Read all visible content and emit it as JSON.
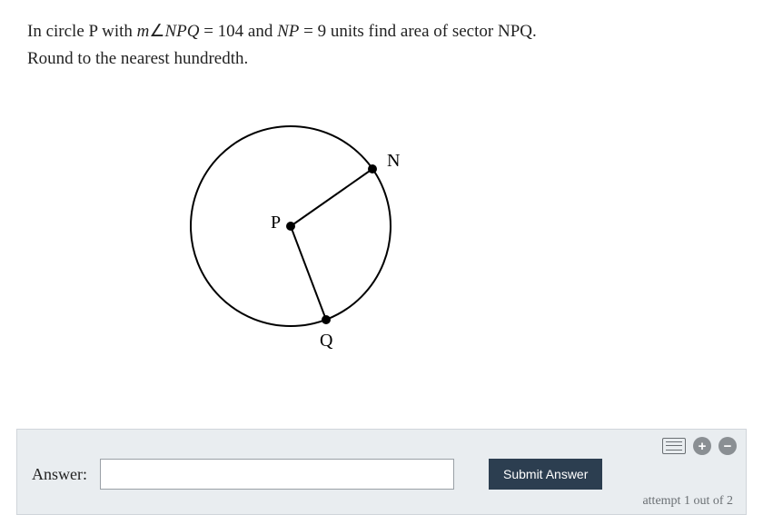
{
  "question": {
    "prefix": "In circle P with ",
    "m_var": "m",
    "angle_sym": "∠",
    "angle_name": "NPQ",
    "eq1": " = 104",
    "and": " and ",
    "np_var": "NP",
    "eq2": " = 9",
    "rest": " units find area of sector NPQ.",
    "line2": "Round to the nearest hundredth."
  },
  "diagram": {
    "label_P": "P",
    "label_N": "N",
    "label_Q": "Q"
  },
  "answer_panel": {
    "label": "Answer:",
    "input_value": "",
    "submit_label": "Submit Answer",
    "attempt_text": "attempt 1 out of 2",
    "plus": "+",
    "minus": "−"
  },
  "chart_data": {
    "type": "diagram",
    "shape": "circle-with-sector",
    "center_label": "P",
    "radius_endpoints": [
      "N",
      "Q"
    ],
    "angle_NPQ_deg": 104,
    "radius_NP": 9
  }
}
